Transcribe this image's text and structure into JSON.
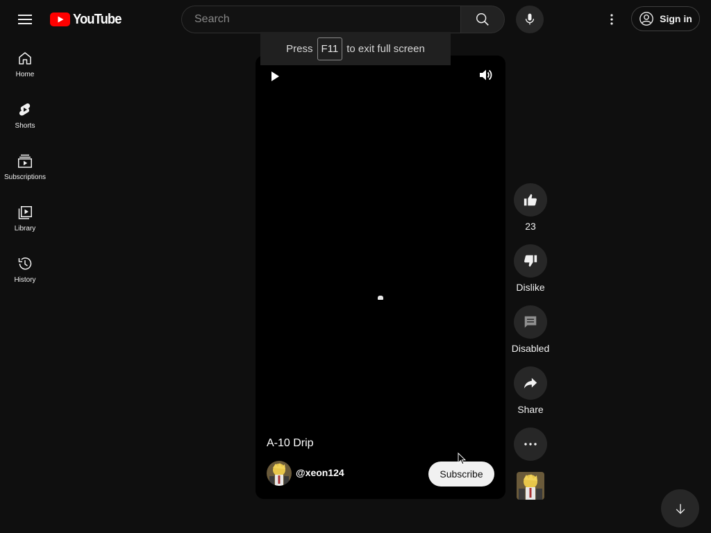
{
  "header": {
    "logo_text": "YouTube",
    "search_placeholder": "Search",
    "sign_in_label": "Sign in"
  },
  "fullscreen_toast": {
    "prefix": "Press",
    "key": "F11",
    "suffix": "to exit full screen"
  },
  "sidebar": {
    "items": [
      {
        "label": "Home",
        "icon": "home-icon"
      },
      {
        "label": "Shorts",
        "icon": "shorts-icon"
      },
      {
        "label": "Subscriptions",
        "icon": "subscriptions-icon"
      },
      {
        "label": "Library",
        "icon": "library-icon"
      },
      {
        "label": "History",
        "icon": "history-icon"
      }
    ]
  },
  "short": {
    "title": "A-10 Drip",
    "channel": "@xeon124",
    "subscribe_label": "Subscribe"
  },
  "actions": {
    "like_count": "23",
    "dislike_label": "Dislike",
    "comments_label": "Disabled",
    "share_label": "Share"
  },
  "colors": {
    "background": "#0f0f0f",
    "brand_red": "#ff0000",
    "button_bg": "#272727",
    "subscribe_bg": "#f1f1f1"
  }
}
